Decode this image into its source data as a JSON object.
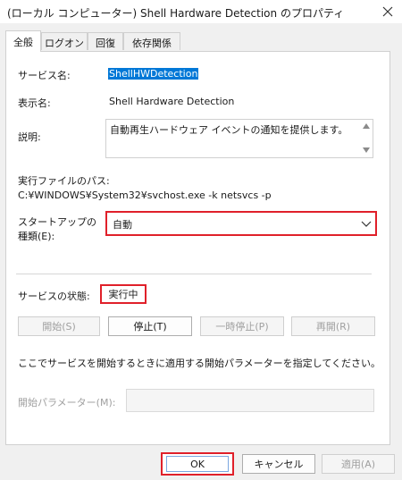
{
  "window": {
    "title": "(ローカル コンピューター) Shell Hardware Detection のプロパティ",
    "close_icon": "close-icon"
  },
  "tabs": [
    {
      "label": "全般",
      "active": true
    },
    {
      "label": "ログオン",
      "active": false
    },
    {
      "label": "回復",
      "active": false
    },
    {
      "label": "依存関係",
      "active": false
    }
  ],
  "general": {
    "service_name_label": "サービス名:",
    "service_name_value": "ShellHWDetection",
    "display_name_label": "表示名:",
    "display_name_value": "Shell Hardware Detection",
    "description_label": "説明:",
    "description_value": "自動再生ハードウェア イベントの通知を提供します。",
    "exe_path_label": "実行ファイルのパス:",
    "exe_path_value": "C:¥WINDOWS¥System32¥svchost.exe -k netsvcs -p",
    "startup_label_line1": "スタートアップの",
    "startup_label_line2": "種類(E):",
    "startup_value": "自動",
    "status_label": "サービスの状態:",
    "status_value": "実行中",
    "buttons": {
      "start": "開始(S)",
      "stop": "停止(T)",
      "pause": "一時停止(P)",
      "resume": "再開(R)"
    },
    "help_text": "ここでサービスを開始するときに適用する開始パラメーターを指定してください。",
    "param_label": "開始パラメーター(M):",
    "param_value": ""
  },
  "footer": {
    "ok": "OK",
    "cancel": "キャンセル",
    "apply": "適用(A)"
  },
  "colors": {
    "highlight": "#e0202a",
    "selection": "#0078d7"
  }
}
